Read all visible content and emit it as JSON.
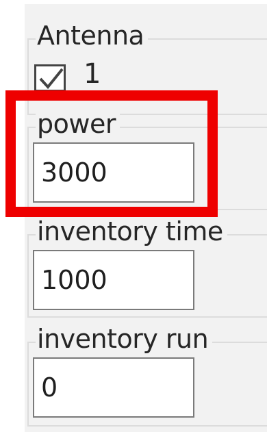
{
  "antenna": {
    "title": "Antenna",
    "checkbox_label": "1",
    "checked": true
  },
  "power": {
    "label": "power",
    "value": "3000"
  },
  "inventory_time": {
    "label": "inventory time",
    "value": "1000"
  },
  "inventory_run": {
    "label": "inventory run",
    "value": "0"
  },
  "icons": {
    "checkbox": "checkmark-icon"
  },
  "colors": {
    "highlight": "#ee0000",
    "panel_background": "#f2f2f2"
  }
}
